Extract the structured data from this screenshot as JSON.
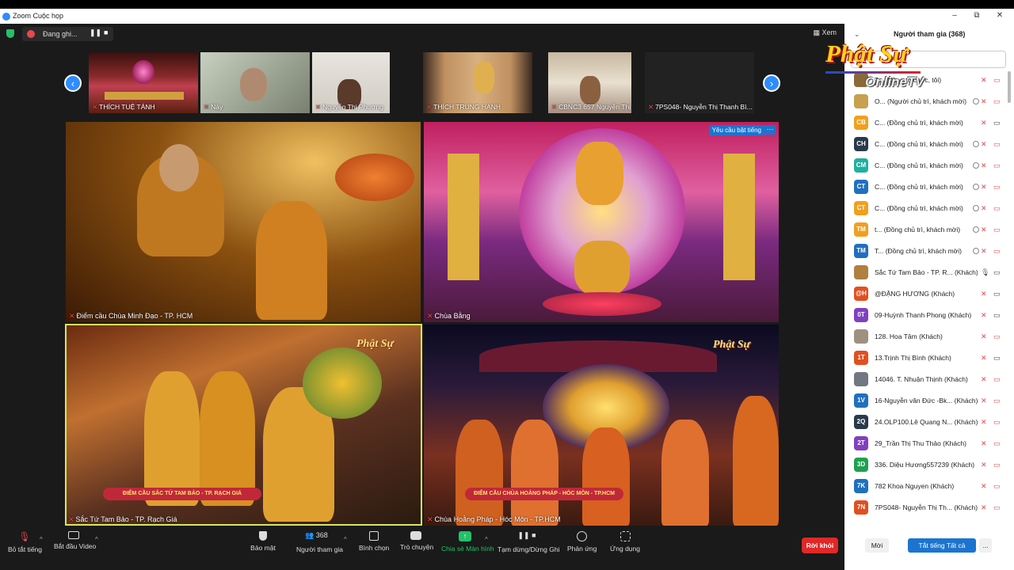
{
  "window": {
    "title": "Zoom Cuộc họp",
    "minimize": "‒",
    "maximize": "⧉",
    "close": "✕"
  },
  "topbar": {
    "recording_label": "Đang ghi...",
    "pause_icon": "pause-icon",
    "stop_icon": "stop-icon",
    "view_label": "Xem"
  },
  "strip": {
    "thumbnails": [
      {
        "name": "THÍCH TUỆ TÁNH"
      },
      {
        "name": "Này"
      },
      {
        "name": "Nguyễn Thị Phương"
      },
      {
        "name": "THÍCH TRUNG HẠNH"
      },
      {
        "name": "CBNC3 657 Nguyễn Thị Huệ p..."
      },
      {
        "name": "7PS048- Nguyễn Thị Thanh Bì..."
      }
    ],
    "prev_arrow": "‹",
    "next_arrow": "›"
  },
  "tiles": {
    "t1": {
      "name": "Điểm cầu Chùa Minh Đạo - TP. HCM"
    },
    "t2": {
      "name": "Chùa Bằng",
      "request_label": "Yêu cầu bật tiếng",
      "more": "···"
    },
    "t3": {
      "name": "Sắc Tứ Tam Bảo - TP. Rạch Giá",
      "logo": "Phật Sự",
      "banner": "ĐIỂM CẦU SẮC TỨ TAM BẢO - TP. RẠCH GIÁ"
    },
    "t4": {
      "name": "Chùa Hoằng Pháp - Hóc Môn - TP.HCM",
      "logo": "Phật Sự",
      "banner": "ĐIỂM CẦU CHÙA HOẰNG PHÁP - HÓC MÔN - TP.HCM"
    }
  },
  "toolbar": {
    "mute_all": "Bỏ tắt tiếng",
    "start_video": "Bắt đầu Video",
    "security": "Bảo mật",
    "participants": "Người tham gia",
    "participants_count": "368",
    "polls": "Bình chọn",
    "chat": "Trò chuyện",
    "share": "Chia sẻ Màn hình",
    "pause_record": "Tạm dừng/Dừng Ghi",
    "reactions": "Phản ứng",
    "apps": "Ứng dụng",
    "leave": "Rời khỏi"
  },
  "panel": {
    "title": "Người tham gia (368)",
    "logo_main": "Phật Sự",
    "logo_sub": "OnlineTV",
    "participants": [
      {
        "initials": "",
        "color": "#8a6a3a",
        "name": "T... (Đồng tổ chức, tôi)",
        "cam_off": false
      },
      {
        "initials": "",
        "color": "#c8a050",
        "name": "O... (Người chủ trì, khách mời)",
        "cam_off": false
      },
      {
        "initials": "CB",
        "color": "#f0a020",
        "name": "C... (Đồng chủ trì, khách mời)",
        "cam_off": true
      },
      {
        "initials": "CH",
        "color": "#2a3a4a",
        "name": "C... (Đồng chủ trì, khách mời)",
        "cam_off": false
      },
      {
        "initials": "CM",
        "color": "#20b0a0",
        "name": "C... (Đồng chủ trì, khách mời)",
        "cam_off": false
      },
      {
        "initials": "CT",
        "color": "#2070c0",
        "name": "C... (Đồng chủ trì, khách mời)",
        "cam_off": false
      },
      {
        "initials": "CT",
        "color": "#f0a020",
        "name": "C... (Đồng chủ trì, khách mời)",
        "cam_off": false
      },
      {
        "initials": "TM",
        "color": "#f0a020",
        "name": "t... (Đồng chủ trì, khách mời)",
        "cam_off": false
      },
      {
        "initials": "TM",
        "color": "#2070c0",
        "name": "T... (Đồng chủ trì, khách mời)",
        "cam_off": false
      },
      {
        "initials": "",
        "color": "#b08040",
        "name": "Sắc Tứ Tam Bảo - TP. R... (Khách)",
        "cam_off": true
      },
      {
        "initials": "@H",
        "color": "#e05020",
        "name": "@ĐẶNG HƯƠNG (Khách)",
        "cam_off": true
      },
      {
        "initials": "0T",
        "color": "#8040c0",
        "name": "09-Huỳnh Thanh Phong (Khách)",
        "cam_off": true
      },
      {
        "initials": "",
        "color": "#a09080",
        "name": "128. Hoa Tâm (Khách)",
        "cam_off": false
      },
      {
        "initials": "1T",
        "color": "#e05020",
        "name": "13.Trịnh Thị Bình (Khách)",
        "cam_off": true
      },
      {
        "initials": "",
        "color": "#707880",
        "name": "14046. T. Nhuận Thịnh (Khách)",
        "cam_off": false
      },
      {
        "initials": "1V",
        "color": "#2070c0",
        "name": "16-Nguyễn văn Đức -Bk... (Khách)",
        "cam_off": false
      },
      {
        "initials": "2Q",
        "color": "#2a3a4a",
        "name": "24.OLP100.Lê Quang N... (Khách)",
        "cam_off": false
      },
      {
        "initials": "2T",
        "color": "#8040c0",
        "name": "29_Trần Thị Thu Thảo (Khách)",
        "cam_off": false
      },
      {
        "initials": "3D",
        "color": "#20a050",
        "name": "336. Diệu Hương557239 (Khách)",
        "cam_off": false
      },
      {
        "initials": "7K",
        "color": "#2070c0",
        "name": "782 Khoa Nguyen (Khách)",
        "cam_off": false
      },
      {
        "initials": "7N",
        "color": "#e05020",
        "name": "7PS048- Nguyễn Thị Th... (Khách)",
        "cam_off": false
      }
    ],
    "footer": {
      "invite": "Mời",
      "mute_all": "Tắt tiếng Tất cả",
      "more": "..."
    }
  }
}
